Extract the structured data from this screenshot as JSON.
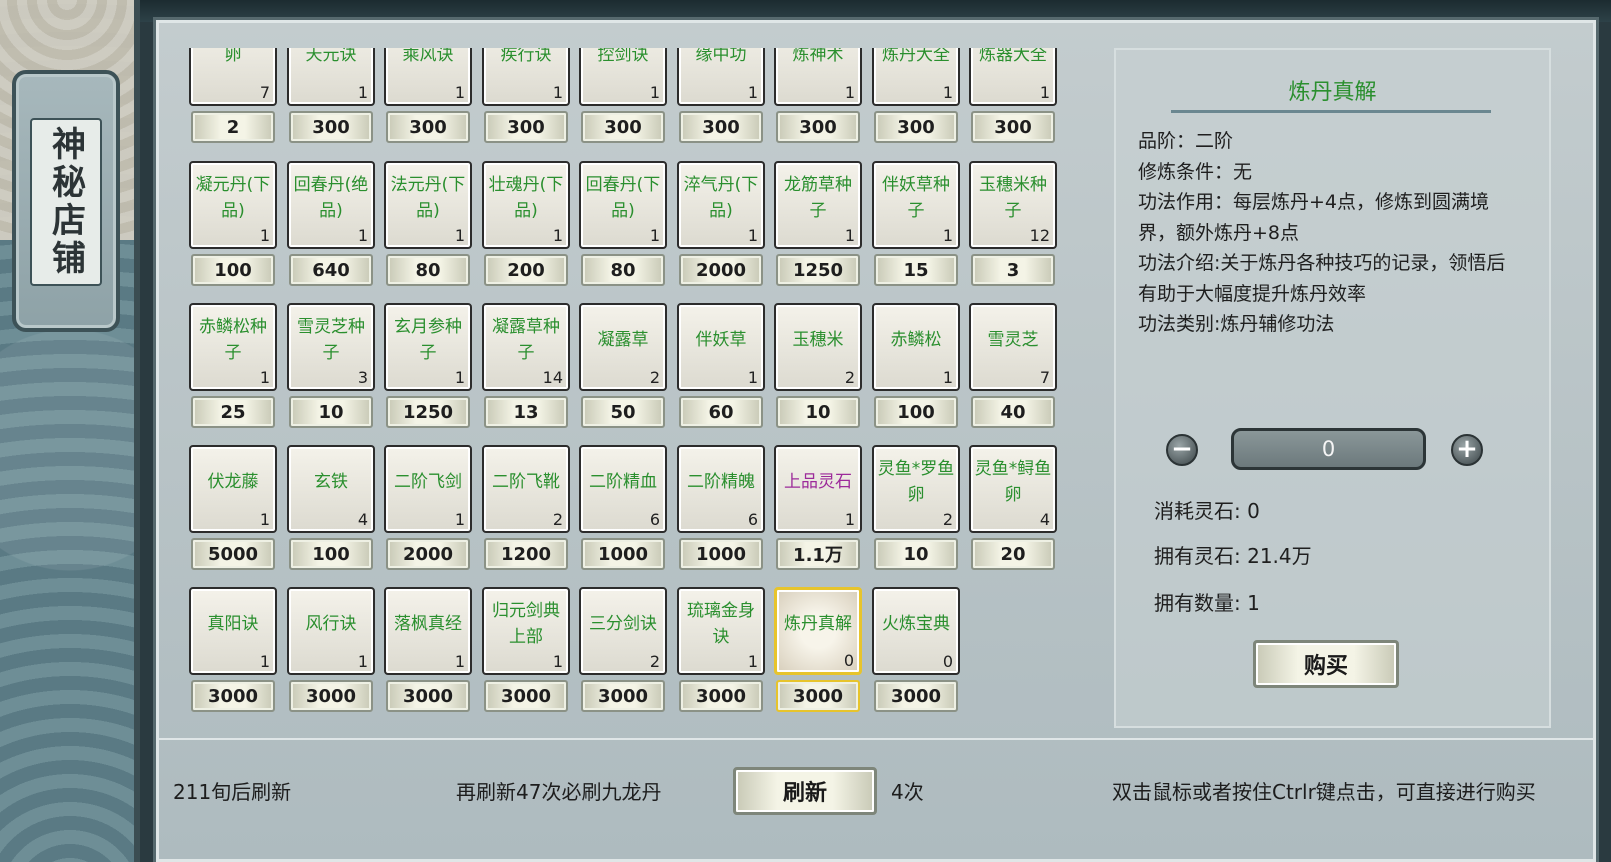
{
  "shop": {
    "title": "神秘店铺"
  },
  "grid": {
    "rows": [
      [
        {
          "name": "卵",
          "count": "7",
          "price": "2"
        },
        {
          "name": "天元诀",
          "count": "1",
          "price": "300"
        },
        {
          "name": "乘风诀",
          "count": "1",
          "price": "300"
        },
        {
          "name": "疾行诀",
          "count": "1",
          "price": "300"
        },
        {
          "name": "控剑诀",
          "count": "1",
          "price": "300"
        },
        {
          "name": "缘中功",
          "count": "1",
          "price": "300"
        },
        {
          "name": "炼神术",
          "count": "1",
          "price": "300"
        },
        {
          "name": "炼丹大全",
          "count": "1",
          "price": "300"
        },
        {
          "name": "炼器大全",
          "count": "1",
          "price": "300"
        }
      ],
      [
        {
          "name": "凝元丹(下品)",
          "count": "1",
          "price": "100"
        },
        {
          "name": "回春丹(绝品)",
          "count": "1",
          "price": "640"
        },
        {
          "name": "法元丹(下品)",
          "count": "1",
          "price": "80"
        },
        {
          "name": "壮魂丹(下品)",
          "count": "1",
          "price": "200"
        },
        {
          "name": "回春丹(下品)",
          "count": "1",
          "price": "80"
        },
        {
          "name": "淬气丹(下品)",
          "count": "1",
          "price": "2000"
        },
        {
          "name": "龙筋草种子",
          "count": "1",
          "price": "1250"
        },
        {
          "name": "伴妖草种子",
          "count": "1",
          "price": "15"
        },
        {
          "name": "玉穗米种子",
          "count": "12",
          "price": "3"
        }
      ],
      [
        {
          "name": "赤鳞松种子",
          "count": "1",
          "price": "25"
        },
        {
          "name": "雪灵芝种子",
          "count": "3",
          "price": "10"
        },
        {
          "name": "玄月参种子",
          "count": "1",
          "price": "1250"
        },
        {
          "name": "凝露草种子",
          "count": "14",
          "price": "13"
        },
        {
          "name": "凝露草",
          "count": "2",
          "price": "50"
        },
        {
          "name": "伴妖草",
          "count": "1",
          "price": "60"
        },
        {
          "name": "玉穗米",
          "count": "2",
          "price": "10"
        },
        {
          "name": "赤鳞松",
          "count": "1",
          "price": "100"
        },
        {
          "name": "雪灵芝",
          "count": "7",
          "price": "40"
        }
      ],
      [
        {
          "name": "伏龙藤",
          "count": "1",
          "price": "5000"
        },
        {
          "name": "玄铁",
          "count": "4",
          "price": "100"
        },
        {
          "name": "二阶飞剑",
          "count": "1",
          "price": "2000"
        },
        {
          "name": "二阶飞靴",
          "count": "2",
          "price": "1200"
        },
        {
          "name": "二阶精血",
          "count": "6",
          "price": "1000"
        },
        {
          "name": "二阶精魄",
          "count": "6",
          "price": "1000"
        },
        {
          "name": "上品灵石",
          "count": "1",
          "price": "1.1万",
          "color": "#9c2a9a"
        },
        {
          "name": "灵鱼*罗鱼卵",
          "count": "2",
          "price": "10"
        },
        {
          "name": "灵鱼*鲟鱼卵",
          "count": "4",
          "price": "20"
        }
      ],
      [
        {
          "name": "真阳诀",
          "count": "1",
          "price": "3000"
        },
        {
          "name": "风行诀",
          "count": "1",
          "price": "3000"
        },
        {
          "name": "落枫真经",
          "count": "1",
          "price": "3000"
        },
        {
          "name": "归元剑典上部",
          "count": "1",
          "price": "3000"
        },
        {
          "name": "三分剑诀",
          "count": "2",
          "price": "3000"
        },
        {
          "name": "琉璃金身诀",
          "count": "1",
          "price": "3000"
        },
        {
          "name": "炼丹真解",
          "count": "0",
          "price": "3000",
          "selected": true
        },
        {
          "name": "火炼宝典",
          "count": "0",
          "price": "3000"
        }
      ]
    ]
  },
  "detail": {
    "title": "炼丹真解",
    "grade": "品阶：二阶",
    "condition": "修炼条件：无",
    "effect": "功法作用：每层炼丹+4点，修炼到圆满境界，额外炼丹+8点",
    "intro": "功法介绍:关于炼丹各种技巧的记录，领悟后有助于大幅度提升炼丹效率",
    "category": "功法类别:炼丹辅修功法",
    "quantity": "0",
    "minus_glyph": "−",
    "plus_glyph": "+",
    "cost": "消耗灵石: 0",
    "owned_stones": "拥有灵石: 21.4万",
    "owned_count": "拥有数量: 1",
    "buy_label": "购买"
  },
  "footer": {
    "refresh_timer": "211旬后刷新",
    "guarantee": "再刷新47次必刷九龙丹",
    "refresh_label": "刷新",
    "refresh_count": "4次",
    "hint": "双击鼠标或者按住Ctrlr键点击，可直接进行购买"
  }
}
